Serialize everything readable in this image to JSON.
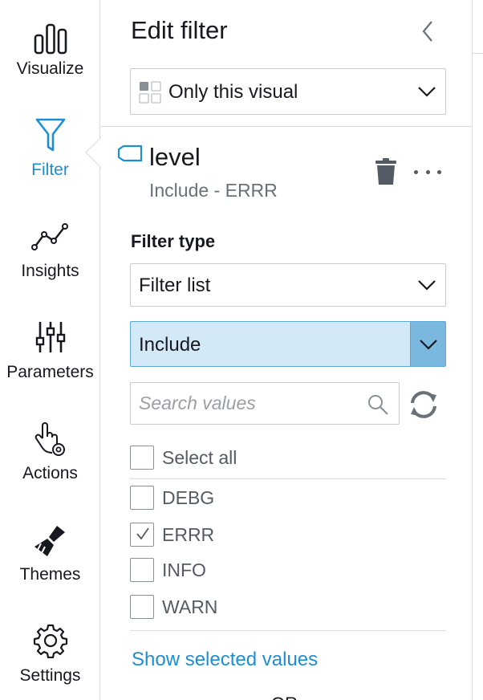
{
  "rail": {
    "items": [
      {
        "label": "Visualize",
        "icon": "bar-chart-icon",
        "active": false
      },
      {
        "label": "Filter",
        "icon": "filter-funnel-icon",
        "active": true
      },
      {
        "label": "Insights",
        "icon": "insights-line-icon",
        "active": false
      },
      {
        "label": "Parameters",
        "icon": "sliders-icon",
        "active": false
      },
      {
        "label": "Actions",
        "icon": "pointer-gear-icon",
        "active": false
      },
      {
        "label": "Themes",
        "icon": "paintbrush-icon",
        "active": false
      },
      {
        "label": "Settings",
        "icon": "gear-icon",
        "active": false
      }
    ],
    "accent_color": "#1b8fd6"
  },
  "panel": {
    "title": "Edit filter",
    "scope_dropdown": {
      "value": "Only this visual",
      "icon": "visual-grid-icon"
    },
    "field": {
      "name": "level",
      "summary": "Include - ERRR",
      "icon": "tag-icon"
    },
    "filter_type": {
      "label": "Filter type",
      "type_value": "Filter list",
      "mode_value": "Include"
    },
    "search": {
      "placeholder": "Search values"
    },
    "select_all": {
      "label": "Select all",
      "checked": false
    },
    "values": [
      {
        "label": "DEBG",
        "checked": false
      },
      {
        "label": "ERRR",
        "checked": true
      },
      {
        "label": "INFO",
        "checked": false
      },
      {
        "label": "WARN",
        "checked": false
      }
    ],
    "show_selected_link": "Show selected values",
    "cut_off_text": "OR"
  }
}
